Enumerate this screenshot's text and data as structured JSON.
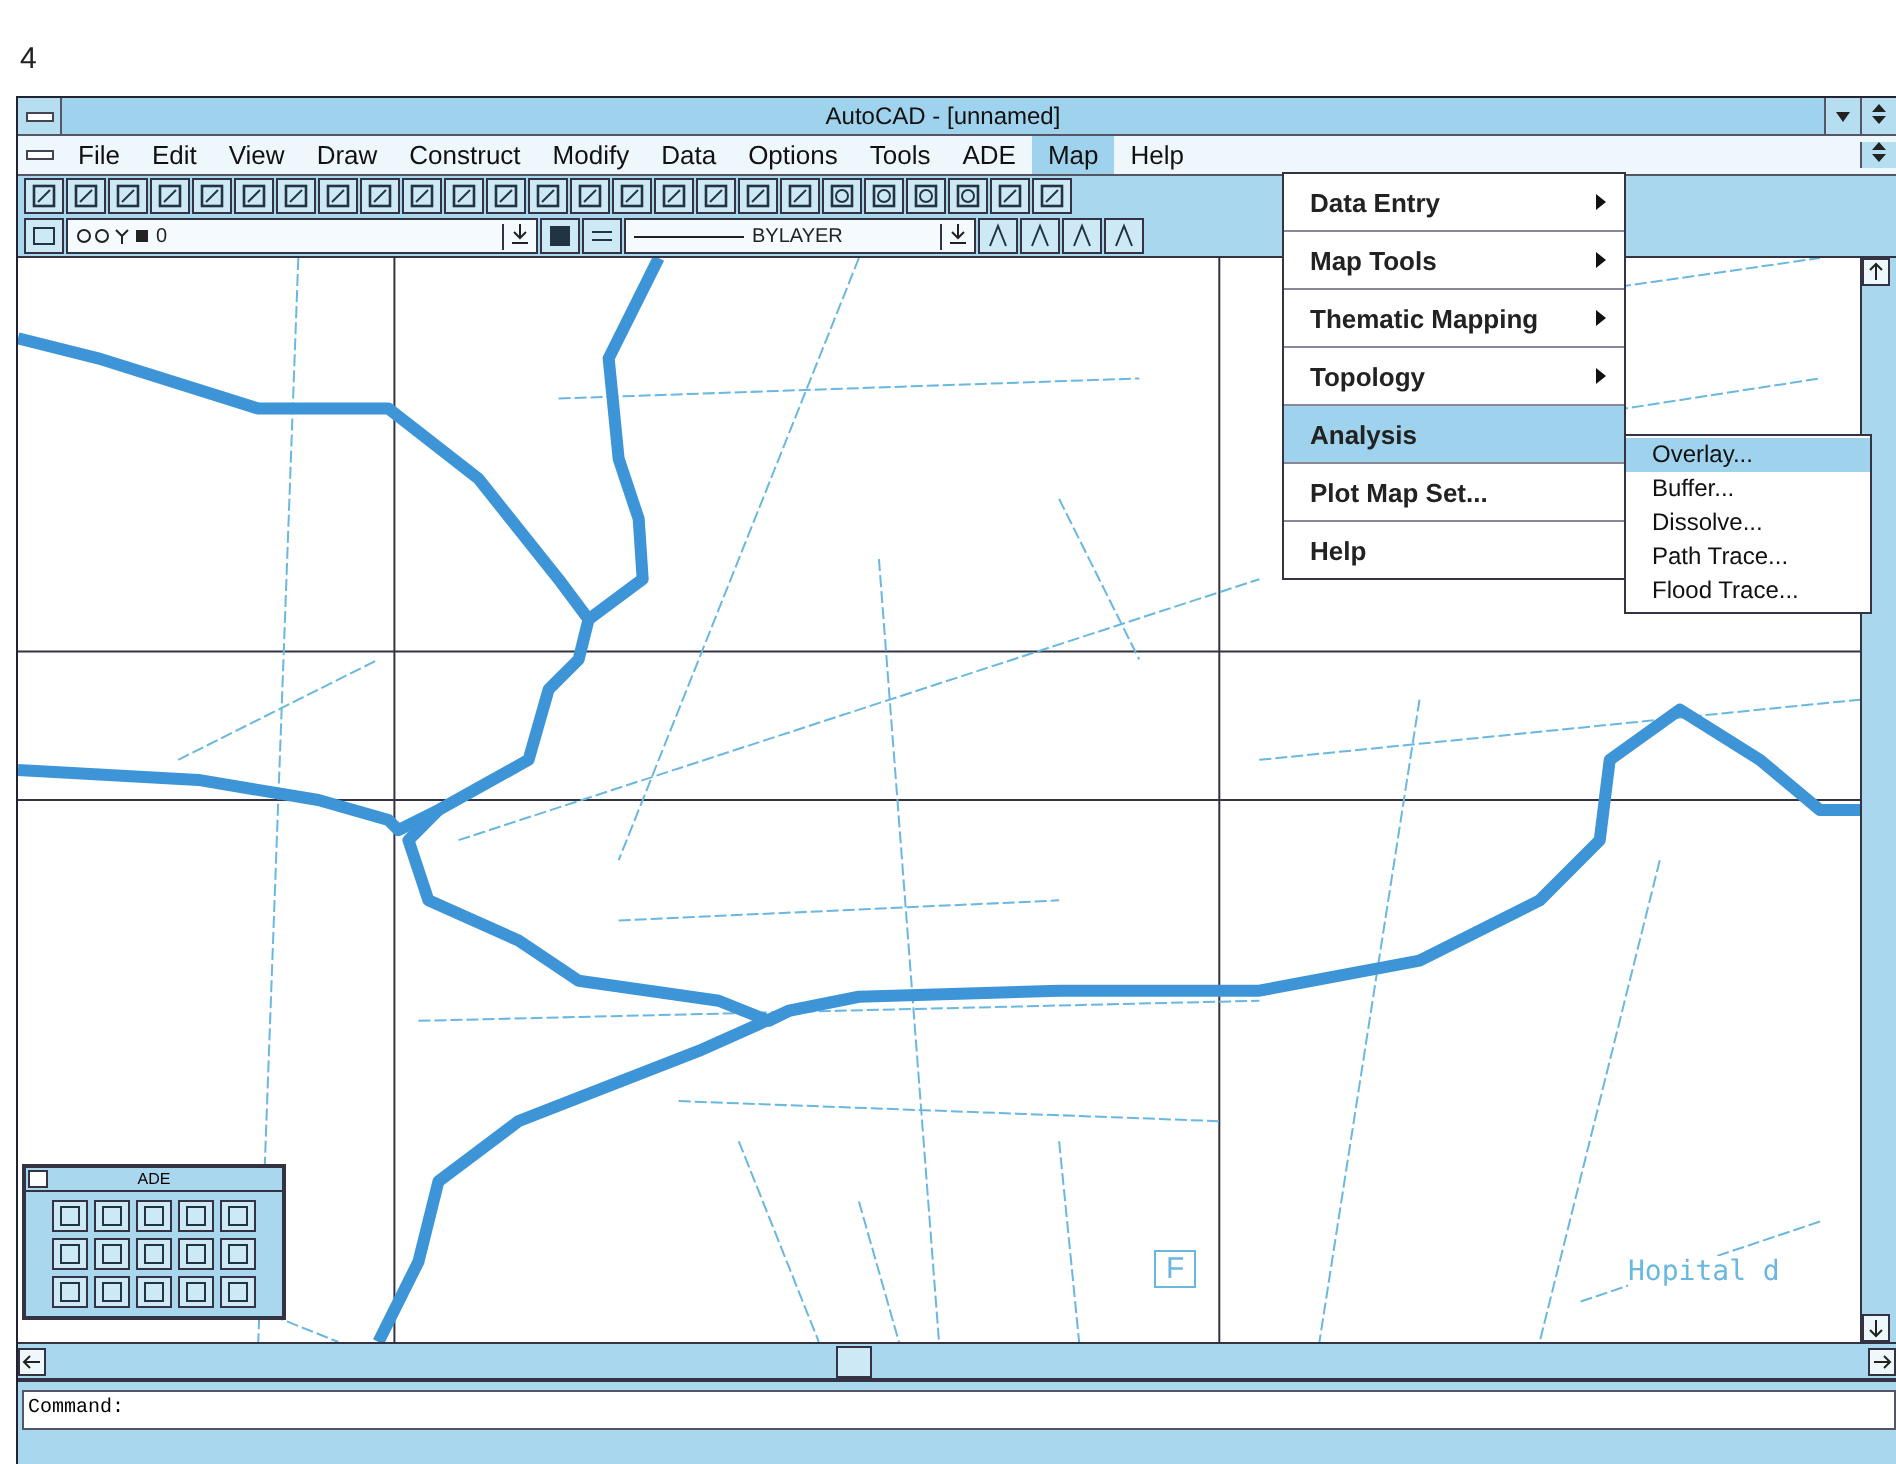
{
  "page_number": "4",
  "window": {
    "title": "AutoCAD - [unnamed]"
  },
  "menu_bar": [
    {
      "label": "File",
      "selected": false
    },
    {
      "label": "Edit",
      "selected": false
    },
    {
      "label": "View",
      "selected": false
    },
    {
      "label": "Draw",
      "selected": false
    },
    {
      "label": "Construct",
      "selected": false
    },
    {
      "label": "Modify",
      "selected": false
    },
    {
      "label": "Data",
      "selected": false
    },
    {
      "label": "Options",
      "selected": false
    },
    {
      "label": "Tools",
      "selected": false
    },
    {
      "label": "ADE",
      "selected": false
    },
    {
      "label": "Map",
      "selected": true
    },
    {
      "label": "Help",
      "selected": false
    }
  ],
  "object_toolbar": {
    "layer": "0",
    "linetype": "BYLAYER"
  },
  "map_menu": [
    {
      "label": "Data Entry",
      "submenu": true,
      "selected": false
    },
    {
      "label": "Map Tools",
      "submenu": true,
      "selected": false
    },
    {
      "label": "Thematic Mapping",
      "submenu": true,
      "selected": false
    },
    {
      "label": "Topology",
      "submenu": true,
      "selected": false
    },
    {
      "label": "Analysis",
      "submenu": false,
      "selected": true
    },
    {
      "label": "Plot Map Set...",
      "submenu": false,
      "selected": false
    },
    {
      "label": "Help",
      "submenu": false,
      "selected": false
    }
  ],
  "analysis_submenu": [
    {
      "label": "Overlay...",
      "selected": true
    },
    {
      "label": "Buffer...",
      "selected": false
    },
    {
      "label": "Dissolve...",
      "selected": false
    },
    {
      "label": "Path Trace...",
      "selected": false
    },
    {
      "label": "Flood Trace...",
      "selected": false
    }
  ],
  "drawing": {
    "label_box": "F",
    "street_label": "Hopital d"
  },
  "ade_toolbox": {
    "title": "ADE"
  },
  "command_line": {
    "prompt": "Command:"
  }
}
